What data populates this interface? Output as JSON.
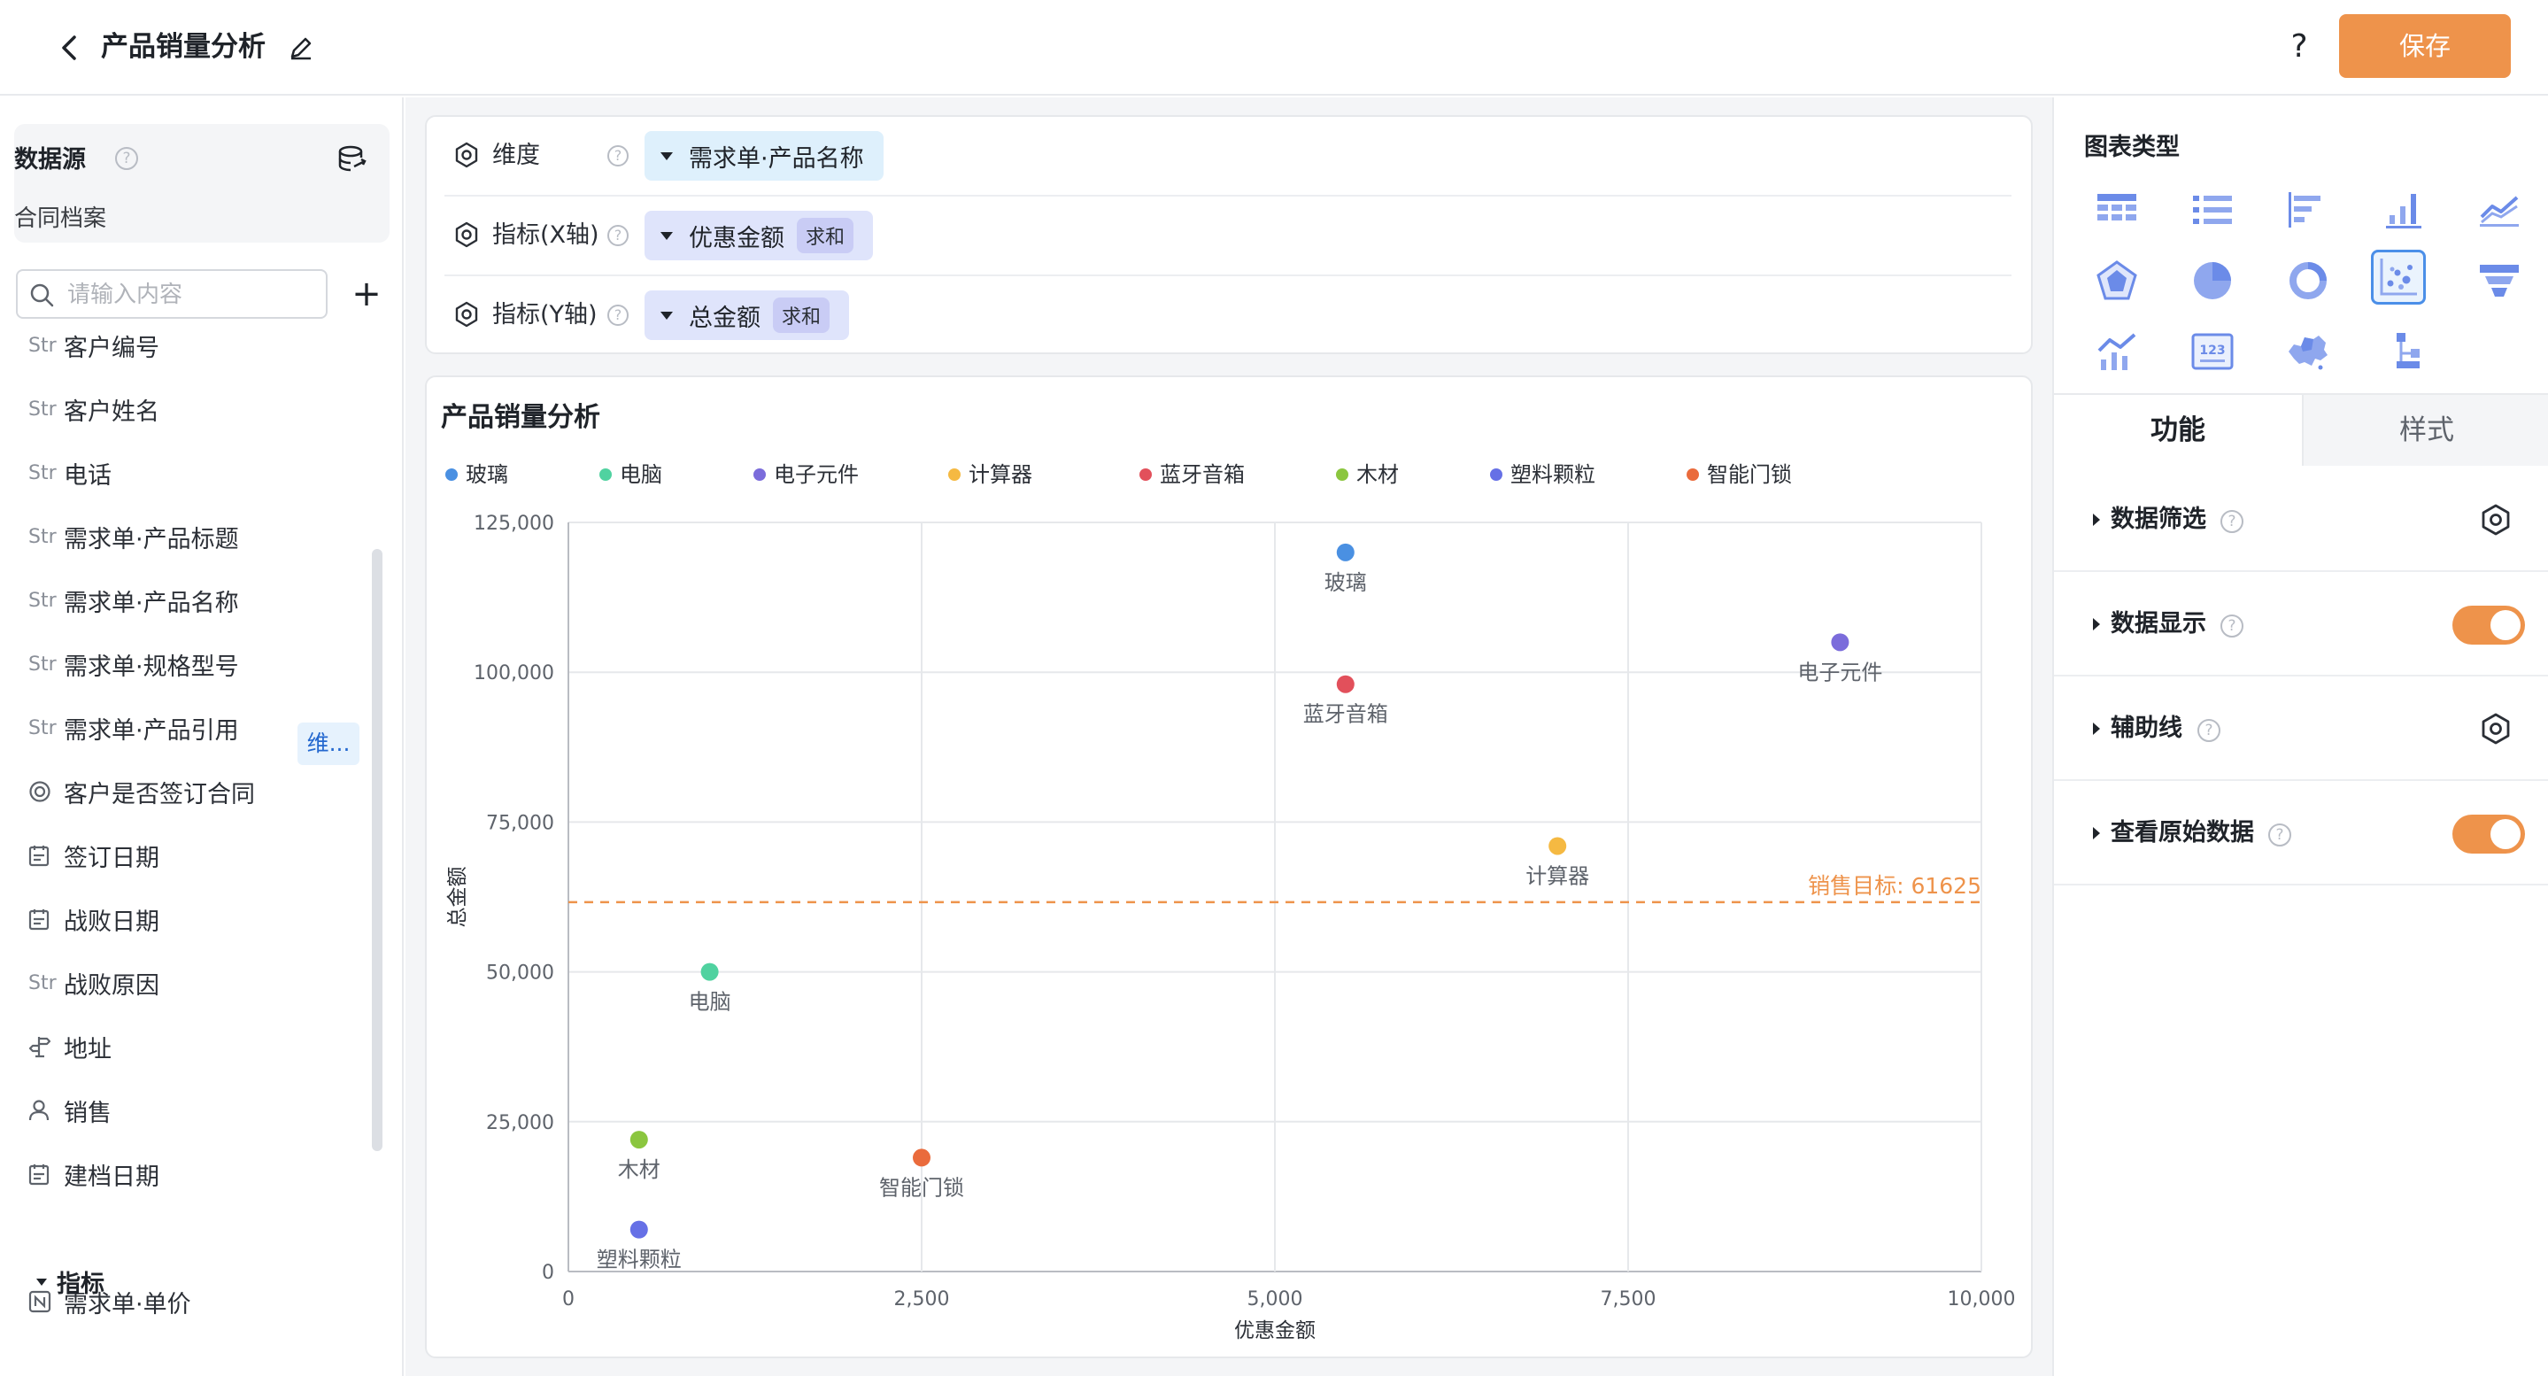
{
  "header": {
    "title": "产品销量分析",
    "help": "?",
    "save_label": "保存"
  },
  "datasource": {
    "title": "数据源",
    "help": "?",
    "name": "合同档案"
  },
  "search": {
    "placeholder": "请输入内容"
  },
  "fields": [
    {
      "type": "Str",
      "label": "客户编号"
    },
    {
      "type": "Str",
      "label": "客户姓名"
    },
    {
      "type": "Str",
      "label": "电话"
    },
    {
      "type": "Str",
      "label": "需求单·产品标题"
    },
    {
      "type": "Str",
      "label": "需求单·产品名称"
    },
    {
      "type": "Str",
      "label": "需求单·规格型号"
    },
    {
      "type": "Str",
      "label": "需求单·产品引用"
    },
    {
      "type": "",
      "label": "客户是否签订合同"
    },
    {
      "type": "",
      "label": "签订日期"
    },
    {
      "type": "",
      "label": "战败日期"
    },
    {
      "type": "Str",
      "label": "战败原因"
    },
    {
      "type": "",
      "label": "地址"
    },
    {
      "type": "",
      "label": "销售"
    },
    {
      "type": "",
      "label": "建档日期"
    }
  ],
  "field_dim_tag": "维...",
  "metrics_section": {
    "label": "指标",
    "items": [
      {
        "label": "需求单·单价"
      }
    ]
  },
  "config": {
    "dimension": {
      "label": "维度",
      "value": "需求单·产品名称"
    },
    "x_metric": {
      "label": "指标(X轴)",
      "value": "优惠金额",
      "agg": "求和"
    },
    "y_metric": {
      "label": "指标(Y轴)",
      "value": "总金额",
      "agg": "求和"
    }
  },
  "chart_data": {
    "type": "scatter",
    "title": "产品销量分析",
    "xlabel": "优惠金额",
    "ylabel": "总金额",
    "xlim": [
      0,
      10000
    ],
    "ylim": [
      0,
      125000
    ],
    "x_ticks": [
      "0",
      "2,500",
      "5,000",
      "7,500",
      "10,000"
    ],
    "y_ticks": [
      "0",
      "25,000",
      "50,000",
      "75,000",
      "100,000",
      "125,000"
    ],
    "grid": true,
    "legend_position": "top",
    "series": [
      {
        "name": "玻璃",
        "color": "#4a90e2",
        "x": 5500,
        "y": 120000
      },
      {
        "name": "电脑",
        "color": "#50d2a0",
        "x": 1000,
        "y": 50000
      },
      {
        "name": "电子元件",
        "color": "#7b6cdb",
        "x": 9000,
        "y": 105000
      },
      {
        "name": "计算器",
        "color": "#f5b942",
        "x": 7000,
        "y": 71000
      },
      {
        "name": "蓝牙音箱",
        "color": "#e2505b",
        "x": 5500,
        "y": 98000
      },
      {
        "name": "木材",
        "color": "#8bc63f",
        "x": 500,
        "y": 22000
      },
      {
        "name": "塑料颗粒",
        "color": "#6670e6",
        "x": 500,
        "y": 7000
      },
      {
        "name": "智能门锁",
        "color": "#ea6b3c",
        "x": 2500,
        "y": 19000
      }
    ],
    "reference_line": {
      "label": "销售目标: 61625",
      "value": 61625,
      "color": "#ee934b"
    }
  },
  "right_panel": {
    "chart_type_title": "图表类型",
    "tabs": [
      "功能",
      "样式"
    ],
    "functions": [
      {
        "label": "数据筛选",
        "control": "gear"
      },
      {
        "label": "数据显示",
        "control": "toggle-on"
      },
      {
        "label": "辅助线",
        "control": "gear"
      },
      {
        "label": "查看原始数据",
        "control": "toggle-on"
      }
    ]
  },
  "colors": {
    "accent": "#ee934b",
    "chart_icon": "#6b8be8",
    "selected_border": "#4b8fe8"
  }
}
